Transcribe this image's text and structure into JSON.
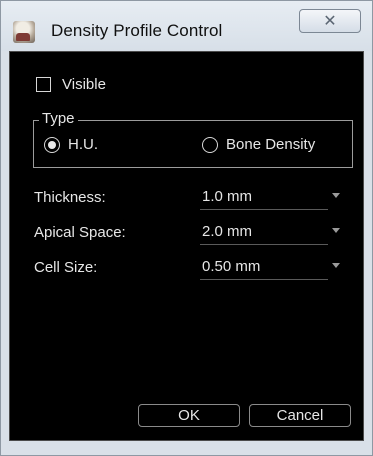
{
  "window": {
    "title": "Density Profile Control",
    "close_glyph": "✕",
    "app_icon": "dental-scan-icon"
  },
  "visible": {
    "label": "Visible",
    "checked": false
  },
  "type_group": {
    "legend": "Type",
    "options": [
      {
        "label": "H.U.",
        "selected": true
      },
      {
        "label": "Bone Density",
        "selected": false
      }
    ]
  },
  "fields": [
    {
      "label": "Thickness:",
      "value": "1.0 mm"
    },
    {
      "label": "Apical Space:",
      "value": "2.0 mm"
    },
    {
      "label": "Cell Size:",
      "value": "0.50 mm"
    }
  ],
  "buttons": {
    "ok": "OK",
    "cancel": "Cancel"
  },
  "colors": {
    "client_bg": "#000000",
    "text": "#e6e6e6",
    "titlebar": "#dfe6ee"
  }
}
